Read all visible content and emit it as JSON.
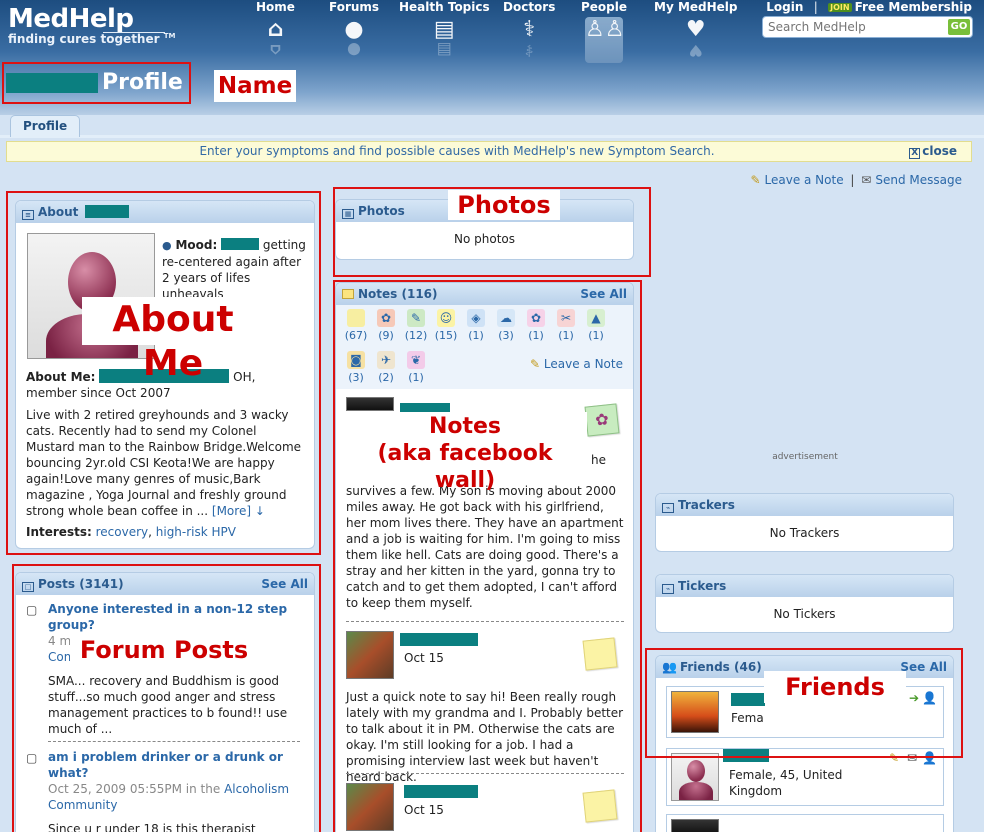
{
  "header": {
    "brand": "MedHelp",
    "tagline": "finding cures together",
    "tm": "TM",
    "nav": [
      {
        "label": "Home",
        "icon": "home-icon",
        "glyph": "⌂"
      },
      {
        "label": "Forums",
        "icon": "speech-bubble-icon",
        "glyph": "💬"
      },
      {
        "label": "Health Topics",
        "icon": "book-icon",
        "glyph": "▤"
      },
      {
        "label": "Doctors",
        "icon": "caduceus-icon",
        "glyph": "⚕"
      },
      {
        "label": "People",
        "icon": "people-icon",
        "glyph": "👥"
      },
      {
        "label": "My MedHelp",
        "icon": "heart-icon",
        "glyph": "♥"
      }
    ],
    "login": "Login",
    "join_badge": "JOIN",
    "free_membership": "Free Membership",
    "search_placeholder": "Search MedHelp",
    "search_button": "GO",
    "profile_title": "Profile"
  },
  "annotations": {
    "name": "Name",
    "about_me": "About Me",
    "photos": "Photos",
    "notes_line1": "Notes",
    "notes_line2": "(aka facebook wall)",
    "forum_posts": "Forum Posts",
    "friends": "Friends"
  },
  "tabs": {
    "profile": "Profile"
  },
  "banner": {
    "message": "Enter your symptoms and find possible causes with MedHelp's new Symptom Search.",
    "close": "close"
  },
  "actions": {
    "leave_note": "Leave a Note",
    "send_message": "Send Message"
  },
  "about": {
    "header": "About",
    "mood_label": "Mood:",
    "mood_text": "getting re-centered again after 2 years of lifes unheavals",
    "about_me_label": "About Me:",
    "location_since": "OH, member since Oct 2007",
    "bio": "Live with 2 retired greyhounds and 3 wacky cats. Recently had to send my Colonel Mustard man to the Rainbow Bridge.Welcome bouncing 2yr.old CSI Keota!We are happy again!Love many genres of music,Bark magazine , Yoga Journal and freshly ground strong whole bean coffee in ...",
    "more": "[More]",
    "interests_label": "Interests:",
    "interests": [
      "recovery",
      "high-risk HPV"
    ]
  },
  "photos": {
    "header": "Photos",
    "empty": "No photos"
  },
  "notes": {
    "header": "Notes (116)",
    "see_all": "See All",
    "leave_note": "Leave a Note",
    "emoticons": [
      {
        "count": "(67)",
        "color": "#f7eea1",
        "glyph": ""
      },
      {
        "count": "(9)",
        "color": "#f6c9b8",
        "glyph": "✿"
      },
      {
        "count": "(12)",
        "color": "#cde9c4",
        "glyph": "✎"
      },
      {
        "count": "(15)",
        "color": "#fbf3a5",
        "glyph": "☺"
      },
      {
        "count": "(1)",
        "color": "#cfe2f6",
        "glyph": "◈"
      },
      {
        "count": "(3)",
        "color": "#d6e7f7",
        "glyph": "☁"
      },
      {
        "count": "(1)",
        "color": "#f6d2e8",
        "glyph": "✿"
      },
      {
        "count": "(1)",
        "color": "#f7d4d4",
        "glyph": "✂"
      },
      {
        "count": "(1)",
        "color": "#d7efd0",
        "glyph": "▲"
      },
      {
        "count": "(3)",
        "color": "#f6e1a3",
        "glyph": "◙"
      },
      {
        "count": "(2)",
        "color": "#efe5cf",
        "glyph": "✈"
      },
      {
        "count": "(1)",
        "color": "#f3cbe9",
        "glyph": "❦"
      }
    ],
    "items": [
      {
        "date": "",
        "text_partial": "he",
        "text": "survives a few. My son is moving about 2000 miles away. He got back with his girlfriend, her mom lives there. They have an apartment and a job is waiting for him. I'm going to miss them like hell. Cats are doing good. There's a stray and her kitten in the yard, gonna try to catch and to get them adopted, I can't afford to keep them myself."
      },
      {
        "date": "Oct 15",
        "text": "Just a quick note to say hi! Been really rough lately with my grandma and I. Probably better to talk about it in PM. Otherwise the cats are okay. I'm still looking for a job. I had a promising interview last week but haven't heard back."
      },
      {
        "date": "Oct 15",
        "text": ""
      }
    ]
  },
  "posts": {
    "header": "Posts (3141)",
    "see_all": "See All",
    "items": [
      {
        "title": "Anyone interested in a non-12 step group?",
        "meta": "4 mi",
        "meta_link": "Comm",
        "snippet": "SMA... recovery and Buddhism is good stuff...so much good anger and stress management practices to b found!! use much of ..."
      },
      {
        "title": "am i problem drinker or a drunk or what?",
        "meta": "Oct 25, 2009 05:55PM in the",
        "meta_link": "Alcoholism Community",
        "snippet": "Since u r under 18 is this therapist"
      }
    ]
  },
  "advertisement": "advertisement",
  "trackers": {
    "header": "Trackers",
    "empty": "No Trackers"
  },
  "tickers": {
    "header": "Tickers",
    "empty": "No Tickers"
  },
  "friends": {
    "header": "Friends (46)",
    "see_all": "See All",
    "items": [
      {
        "detail": "Fema"
      },
      {
        "detail": "Female, 45, United Kingdom"
      }
    ]
  },
  "colors": {
    "redaction": "#0b7f80",
    "annotation_red": "#d11",
    "link": "#2b68a8",
    "panel_header": "#2b5b8e"
  }
}
